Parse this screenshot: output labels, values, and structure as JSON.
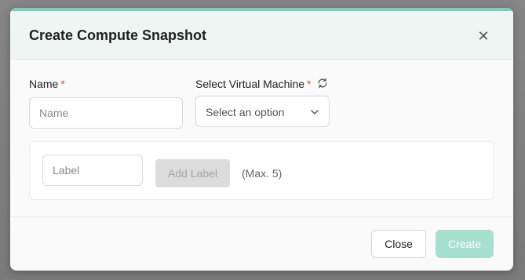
{
  "modal": {
    "title": "Create Compute Snapshot",
    "close_icon": "close-icon"
  },
  "form": {
    "name": {
      "label": "Name",
      "required_mark": "*",
      "placeholder": "Name",
      "value": ""
    },
    "vm_select": {
      "label": "Select Virtual Machine",
      "required_mark": "*",
      "selected": "Select an option",
      "refresh_icon": "refresh-icon",
      "chevron_icon": "chevron-down-icon"
    },
    "labels": {
      "input_placeholder": "Label",
      "add_button": "Add Label",
      "add_button_disabled": true,
      "max_note": "(Max. 5)"
    }
  },
  "footer": {
    "close_label": "Close",
    "create_label": "Create",
    "create_disabled": true
  },
  "colors": {
    "accent": "#7ccfb7",
    "create_disabled_bg": "#a7e0cf",
    "required": "#e0533d"
  }
}
